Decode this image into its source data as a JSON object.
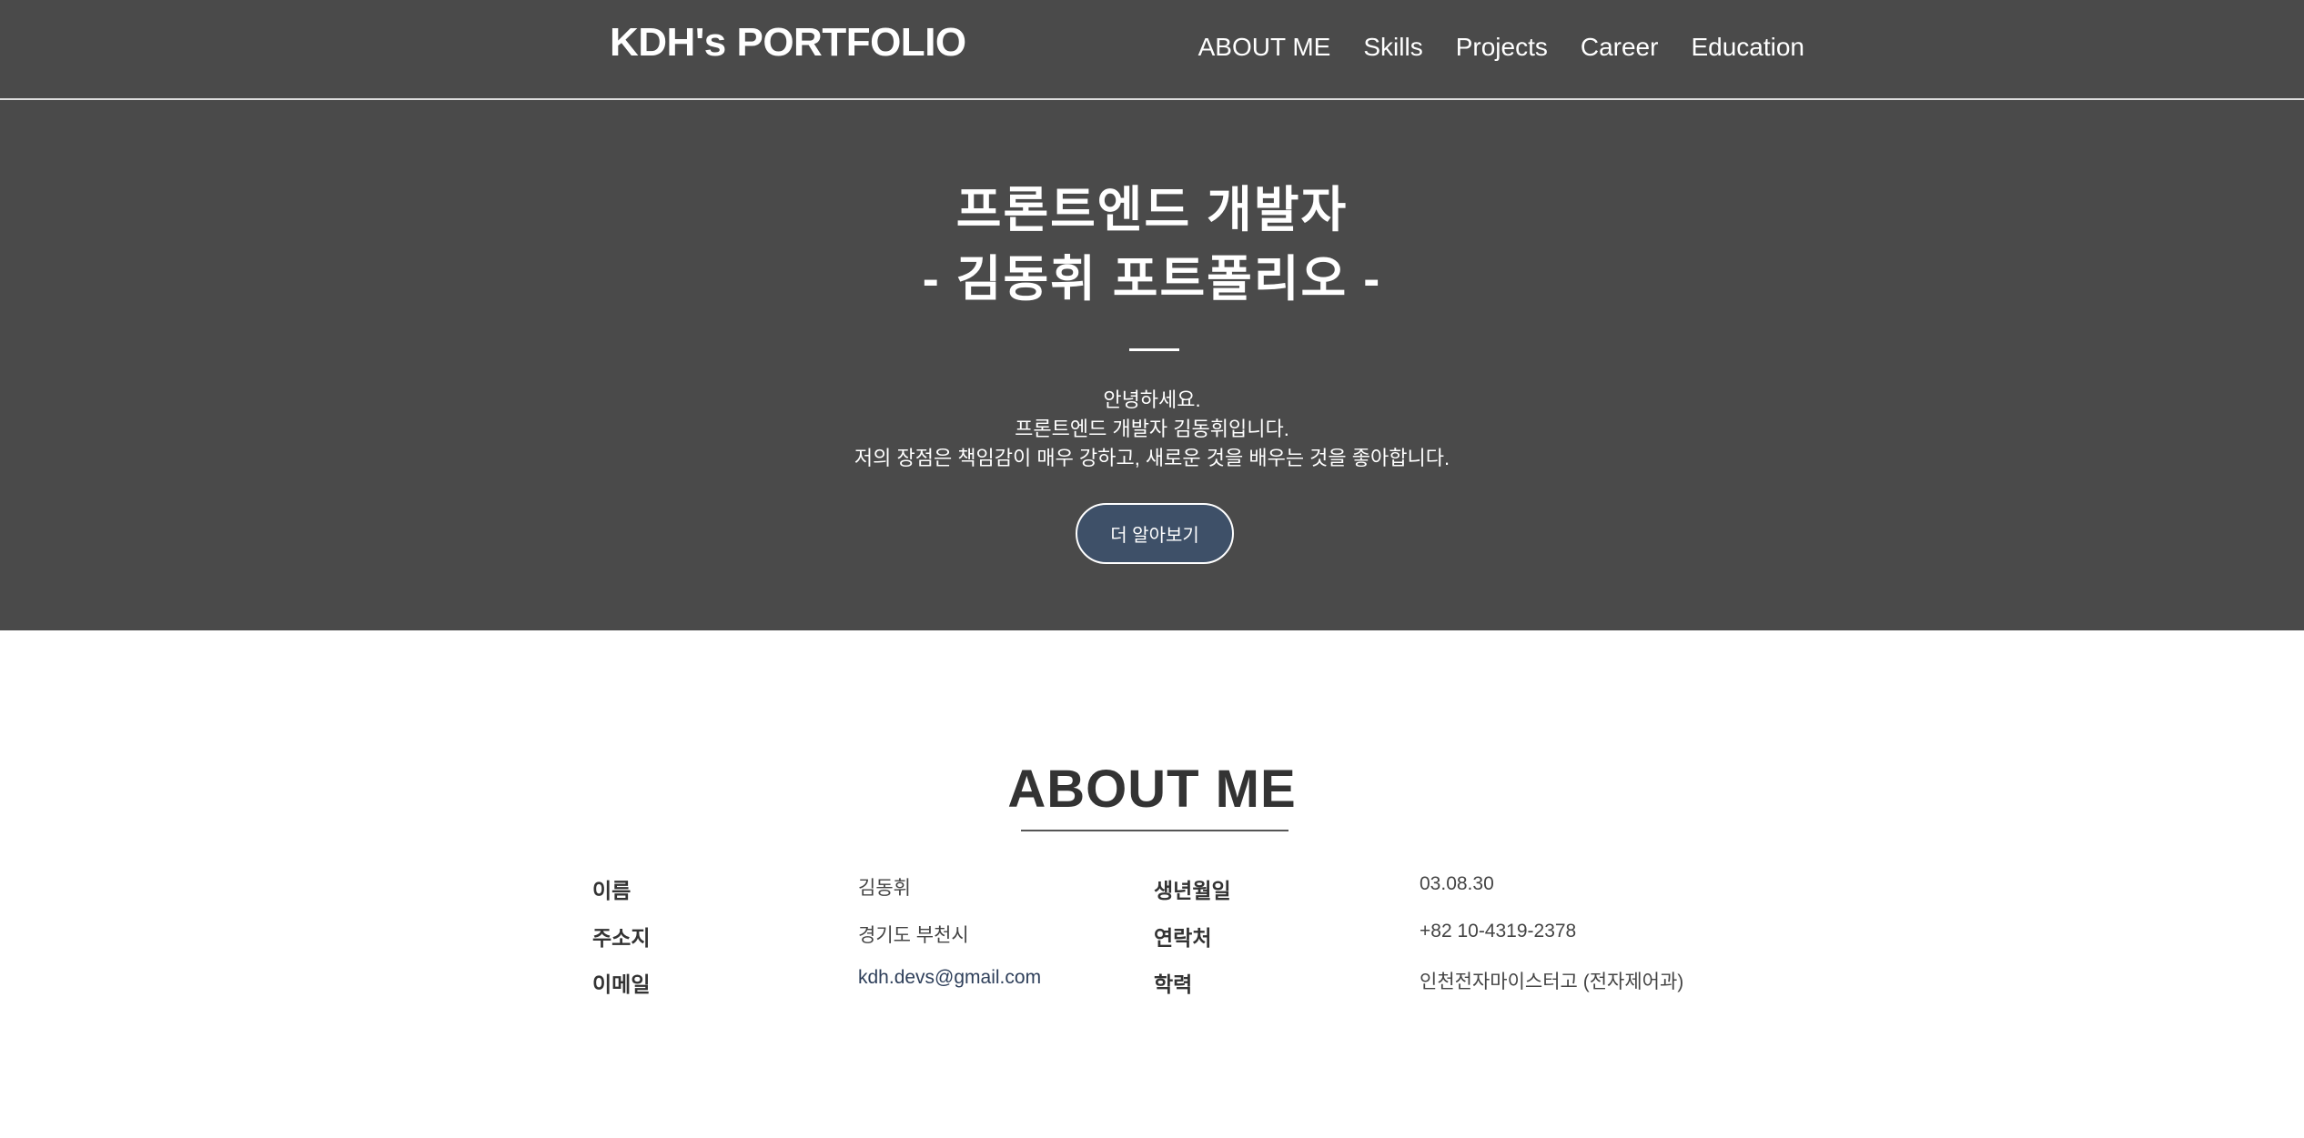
{
  "header": {
    "logo": "KDH's PORTFOLIO",
    "nav": [
      "ABOUT ME",
      "Skills",
      "Projects",
      "Career",
      "Education"
    ]
  },
  "hero": {
    "title_line1": "프론트엔드 개발자",
    "title_line2": "- 김동휘 포트폴리오 -",
    "intro": [
      "안녕하세요.",
      "프론트엔드 개발자 김동휘입니다.",
      "저의 장점은 책임감이 매우 강하고, 새로운 것을 배우는 것을 좋아합니다."
    ],
    "button": "더 알아보기"
  },
  "about": {
    "title": "ABOUT ME",
    "fields": [
      {
        "label": "이름",
        "value": "김동휘"
      },
      {
        "label": "생년월일",
        "value": "03.08.30"
      },
      {
        "label": "주소지",
        "value": "경기도 부천시"
      },
      {
        "label": "연락처",
        "value": "+82 10-4319-2378"
      },
      {
        "label": "이메일",
        "value": "kdh.devs@gmail.com"
      },
      {
        "label": "학력",
        "value": "인천전자마이스터고 (전자제어과)"
      }
    ]
  }
}
